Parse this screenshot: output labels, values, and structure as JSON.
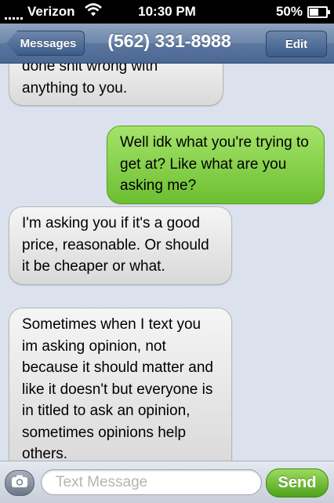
{
  "status_bar": {
    "carrier": "Verizon",
    "time": "10:30 PM",
    "battery": "50%",
    "battery_level": 0.5
  },
  "nav": {
    "back_label": "Messages",
    "title": "(562) 331-8988",
    "edit_label": "Edit"
  },
  "messages": [
    {
      "direction": "incoming",
      "text": "done shit wrong with anything to you."
    },
    {
      "direction": "outgoing",
      "text": "Well idk what you're trying to get at? Like what are you asking me?"
    },
    {
      "direction": "incoming",
      "text": "I'm asking you if it's a good price, reasonable. Or should it be cheaper or what."
    },
    {
      "direction": "incoming",
      "text": "Sometimes when I text you im asking opinion, not because it should matter and like it doesn't but everyone is in titled to ask an opinion, sometimes opinions help others."
    }
  ],
  "composer": {
    "placeholder": "Text Message",
    "send_label": "Send"
  },
  "icons": {
    "wifi": "wifi-icon",
    "camera": "camera-icon",
    "signal": "signal-icon",
    "battery": "battery-icon"
  },
  "colors": {
    "outgoing_bubble": "#7ccb3f",
    "incoming_bubble": "#e6e6e6",
    "navbar": "#5b769e",
    "send_button": "#5fb12a"
  }
}
